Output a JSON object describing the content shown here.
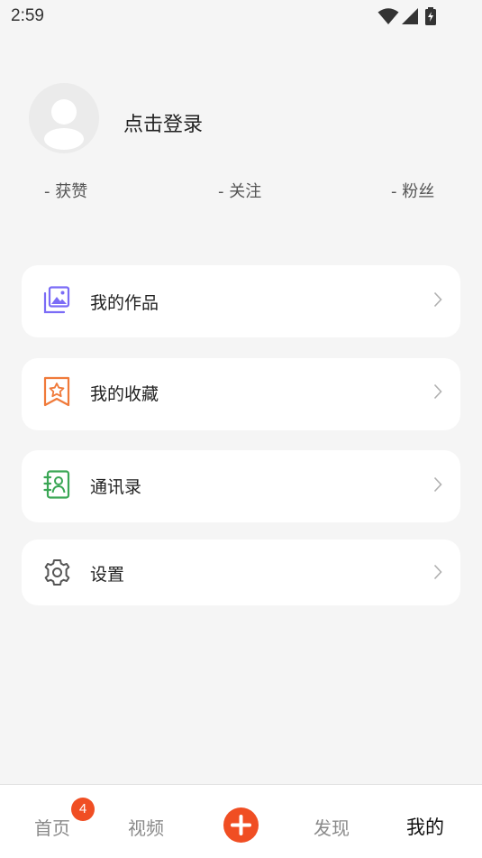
{
  "status_bar": {
    "time": "2:59",
    "icons": [
      "wifi-icon",
      "cell-signal-icon",
      "battery-charging-icon"
    ]
  },
  "profile": {
    "login_label": "点击登录",
    "avatar_icon": "default-avatar-icon"
  },
  "stats": {
    "likes": "- 获赞",
    "following": "- 关注",
    "followers": "- 粉丝"
  },
  "menu": {
    "works": {
      "label": "我的作品",
      "icon": "gallery-icon",
      "color": "#7b6cf6"
    },
    "favorites": {
      "label": "我的收藏",
      "icon": "star-bookmark-icon",
      "color": "#f07a3a"
    },
    "contacts": {
      "label": "通讯录",
      "icon": "contacts-icon",
      "color": "#3aa655"
    },
    "settings": {
      "label": "设置",
      "icon": "gear-icon",
      "color": "#555555"
    }
  },
  "tabbar": {
    "home": "首页",
    "home_badge": "4",
    "video": "视频",
    "add_icon": "plus-icon",
    "discover": "发现",
    "mine": "我的",
    "accent_color": "#f04e23"
  }
}
